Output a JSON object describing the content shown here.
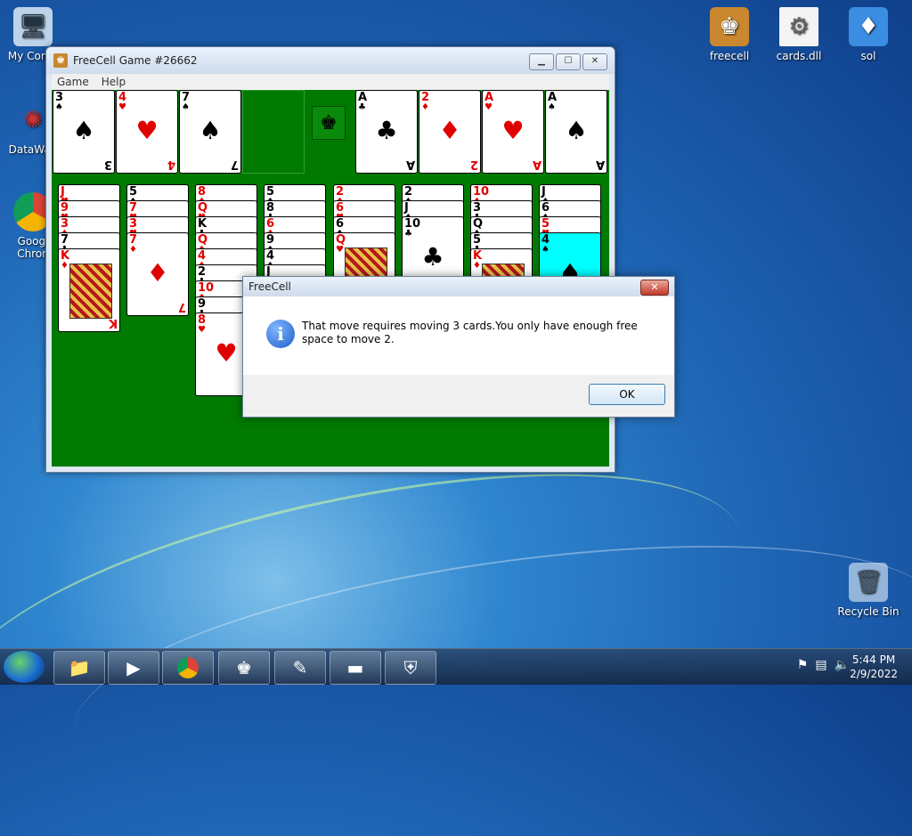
{
  "desktop": {
    "left_icons": [
      {
        "label": "My Comp",
        "icon": "computer-icon"
      },
      {
        "label": "DataWag",
        "icon": "datawag-icon"
      },
      {
        "label": "Googl",
        "label2": "Chron",
        "icon": "chrome-icon"
      }
    ],
    "right_icons": [
      {
        "label": "freecell",
        "icon": "freecell-icon"
      },
      {
        "label": "cards.dll",
        "icon": "dll-file-icon"
      },
      {
        "label": "sol",
        "icon": "sol-icon"
      }
    ],
    "recycle_bin": {
      "label": "Recycle Bin",
      "icon": "recycle-bin-icon"
    }
  },
  "window": {
    "title": "FreeCell Game #26662",
    "menu": [
      "Game",
      "Help"
    ]
  },
  "game": {
    "free_cells": [
      {
        "rank": "3",
        "suit": "♠"
      },
      {
        "rank": "4",
        "suit": "♥"
      },
      {
        "rank": "7",
        "suit": "♠"
      },
      null
    ],
    "foundations": [
      {
        "rank": "A",
        "suit": "♣"
      },
      {
        "rank": "2",
        "suit": "♦"
      },
      {
        "rank": "A",
        "suit": "♥"
      },
      {
        "rank": "A",
        "suit": "♠"
      }
    ],
    "columns": [
      [
        {
          "rank": "J",
          "suit": "♥"
        },
        {
          "rank": "9",
          "suit": "♥"
        },
        {
          "rank": "3",
          "suit": "♦"
        },
        {
          "rank": "7",
          "suit": "♣"
        },
        {
          "rank": "K",
          "suit": "♦"
        }
      ],
      [
        {
          "rank": "5",
          "suit": "♠"
        },
        {
          "rank": "7",
          "suit": "♥"
        },
        {
          "rank": "3",
          "suit": "♥"
        },
        {
          "rank": "7",
          "suit": "♦"
        }
      ],
      [
        {
          "rank": "8",
          "suit": "♦"
        },
        {
          "rank": "Q",
          "suit": "♥"
        },
        {
          "rank": "K",
          "suit": "♣"
        },
        {
          "rank": "Q",
          "suit": "♦"
        },
        {
          "rank": "4",
          "suit": "♦"
        },
        {
          "rank": "2",
          "suit": "♣"
        },
        {
          "rank": "10",
          "suit": "♦"
        },
        {
          "rank": "9",
          "suit": "♣"
        },
        {
          "rank": "8",
          "suit": "♥"
        }
      ],
      [
        {
          "rank": "5",
          "suit": "♠"
        },
        {
          "rank": "8",
          "suit": "♣"
        },
        {
          "rank": "6",
          "suit": "♦"
        },
        {
          "rank": "9",
          "suit": "♠"
        },
        {
          "rank": "4",
          "suit": "♠"
        },
        {
          "rank": "J",
          "suit": "♣"
        }
      ],
      [
        {
          "rank": "2",
          "suit": "♦"
        },
        {
          "rank": "6",
          "suit": "♥"
        },
        {
          "rank": "6",
          "suit": "♠"
        },
        {
          "rank": "Q",
          "suit": "♥"
        }
      ],
      [
        {
          "rank": "2",
          "suit": "♠"
        },
        {
          "rank": "J",
          "suit": "♠"
        },
        {
          "rank": "10",
          "suit": "♣"
        }
      ],
      [
        {
          "rank": "10",
          "suit": "♦"
        },
        {
          "rank": "3",
          "suit": "♣"
        },
        {
          "rank": "Q",
          "suit": "♠"
        },
        {
          "rank": "5",
          "suit": "♣"
        },
        {
          "rank": "K",
          "suit": "♦"
        }
      ],
      [
        {
          "rank": "J",
          "suit": "♠"
        },
        {
          "rank": "6",
          "suit": "♠"
        },
        {
          "rank": "5",
          "suit": "♥"
        },
        {
          "rank": "4",
          "suit": "♠",
          "selected": true
        }
      ]
    ]
  },
  "dialog": {
    "title": "FreeCell",
    "message": "That move requires moving 3 cards.You only have enough free space to move 2.",
    "ok_label": "OK"
  },
  "taskbar": {
    "buttons": [
      "explorer-icon",
      "media-player-icon",
      "chrome-icon",
      "freecell-icon",
      "notepad-icon",
      "cmd-icon",
      "network-icon"
    ],
    "time": "5:44 PM",
    "date": "2/9/2022"
  },
  "colors": {
    "red_suit": "#e00000",
    "felt": "#007a00",
    "selected": "#00ffff"
  }
}
